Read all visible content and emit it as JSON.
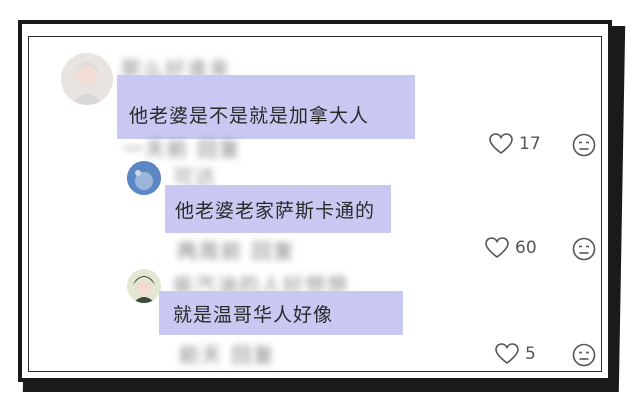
{
  "comments": [
    {
      "text": "他老婆是不是就是加拿大人",
      "likes": "17",
      "username_blurred": "那么好谁来",
      "meta_blurred": "一天前 回复"
    },
    {
      "text": "他老婆老家萨斯卡通的",
      "likes": "60",
      "username_blurred": "可达",
      "meta_blurred": "两周前 回复"
    },
    {
      "text": "就是温哥华人好像",
      "likes": "5",
      "username_blurred": "偷汽油的人好想想",
      "meta_blurred": "前天 回复"
    }
  ],
  "colors": {
    "highlight": "#c8c8f2",
    "text": "#2a2a2a",
    "icon": "#555555"
  },
  "icons": {
    "like": "heart-icon",
    "dislike": "unhappy-face-icon"
  }
}
